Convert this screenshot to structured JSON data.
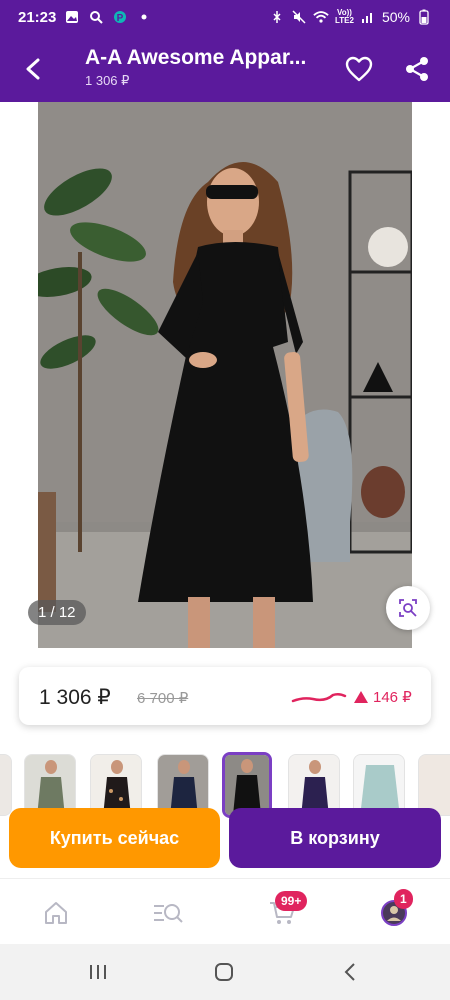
{
  "status_bar": {
    "time": "21:23",
    "signal_label": "Vo))\nLTE2",
    "battery": "50%"
  },
  "header": {
    "title": "A-A Awesome Appar...",
    "subtitle": "1 306 ₽",
    "icons": [
      "back-arrow-icon",
      "heart-icon",
      "share-icon"
    ]
  },
  "gallery": {
    "counter": "1 / 12",
    "colors": {
      "dress": "#111111",
      "wall": "#8d8a86",
      "floor": "#a3a09b"
    }
  },
  "price": {
    "current": "1 306 ₽",
    "old": "6 700 ₽",
    "change": "146 ₽",
    "change_color": "#e0245e"
  },
  "actions": {
    "buy_now": "Купить сейчас",
    "add_to_cart": "В корзину",
    "buy_color": "#ff9800",
    "cart_color": "#5b1a9c"
  },
  "bottom_nav": {
    "cart_badge": "99+",
    "profile_badge": "1",
    "items": [
      "home-icon",
      "catalog-search-icon",
      "cart-icon",
      "profile-icon"
    ]
  },
  "brand": {
    "accent": "#5b1a9c"
  }
}
